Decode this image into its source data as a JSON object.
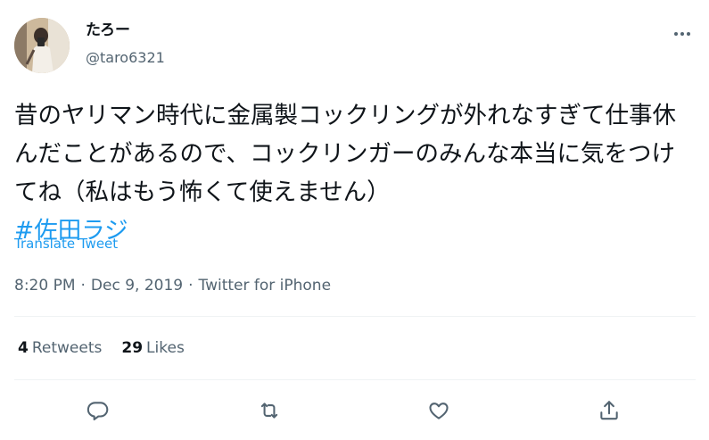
{
  "author": {
    "display_name": "たろー",
    "handle": "@taro6321"
  },
  "tweet": {
    "text": "昔のヤリマン時代に金属製コックリングが外れなすぎて仕事休んだことがあるので、コックリンガーのみんな本当に気をつけてね（私はもう怖くて使えません）",
    "hashtag": "#佐田ラジ",
    "translate_label": "Translate Tweet"
  },
  "meta": {
    "time": "8:20 PM",
    "separator": "·",
    "date": "Dec 9, 2019",
    "source": "Twitter for iPhone"
  },
  "stats": {
    "retweets_count": "4",
    "retweets_label": "Retweets",
    "likes_count": "29",
    "likes_label": "Likes"
  },
  "actions": [
    "reply-icon",
    "retweet-icon",
    "like-icon",
    "share-icon"
  ],
  "colors": {
    "accent": "#1d9bf0",
    "text": "#0f1419",
    "secondary": "#536471",
    "divider": "#eff3f4"
  }
}
